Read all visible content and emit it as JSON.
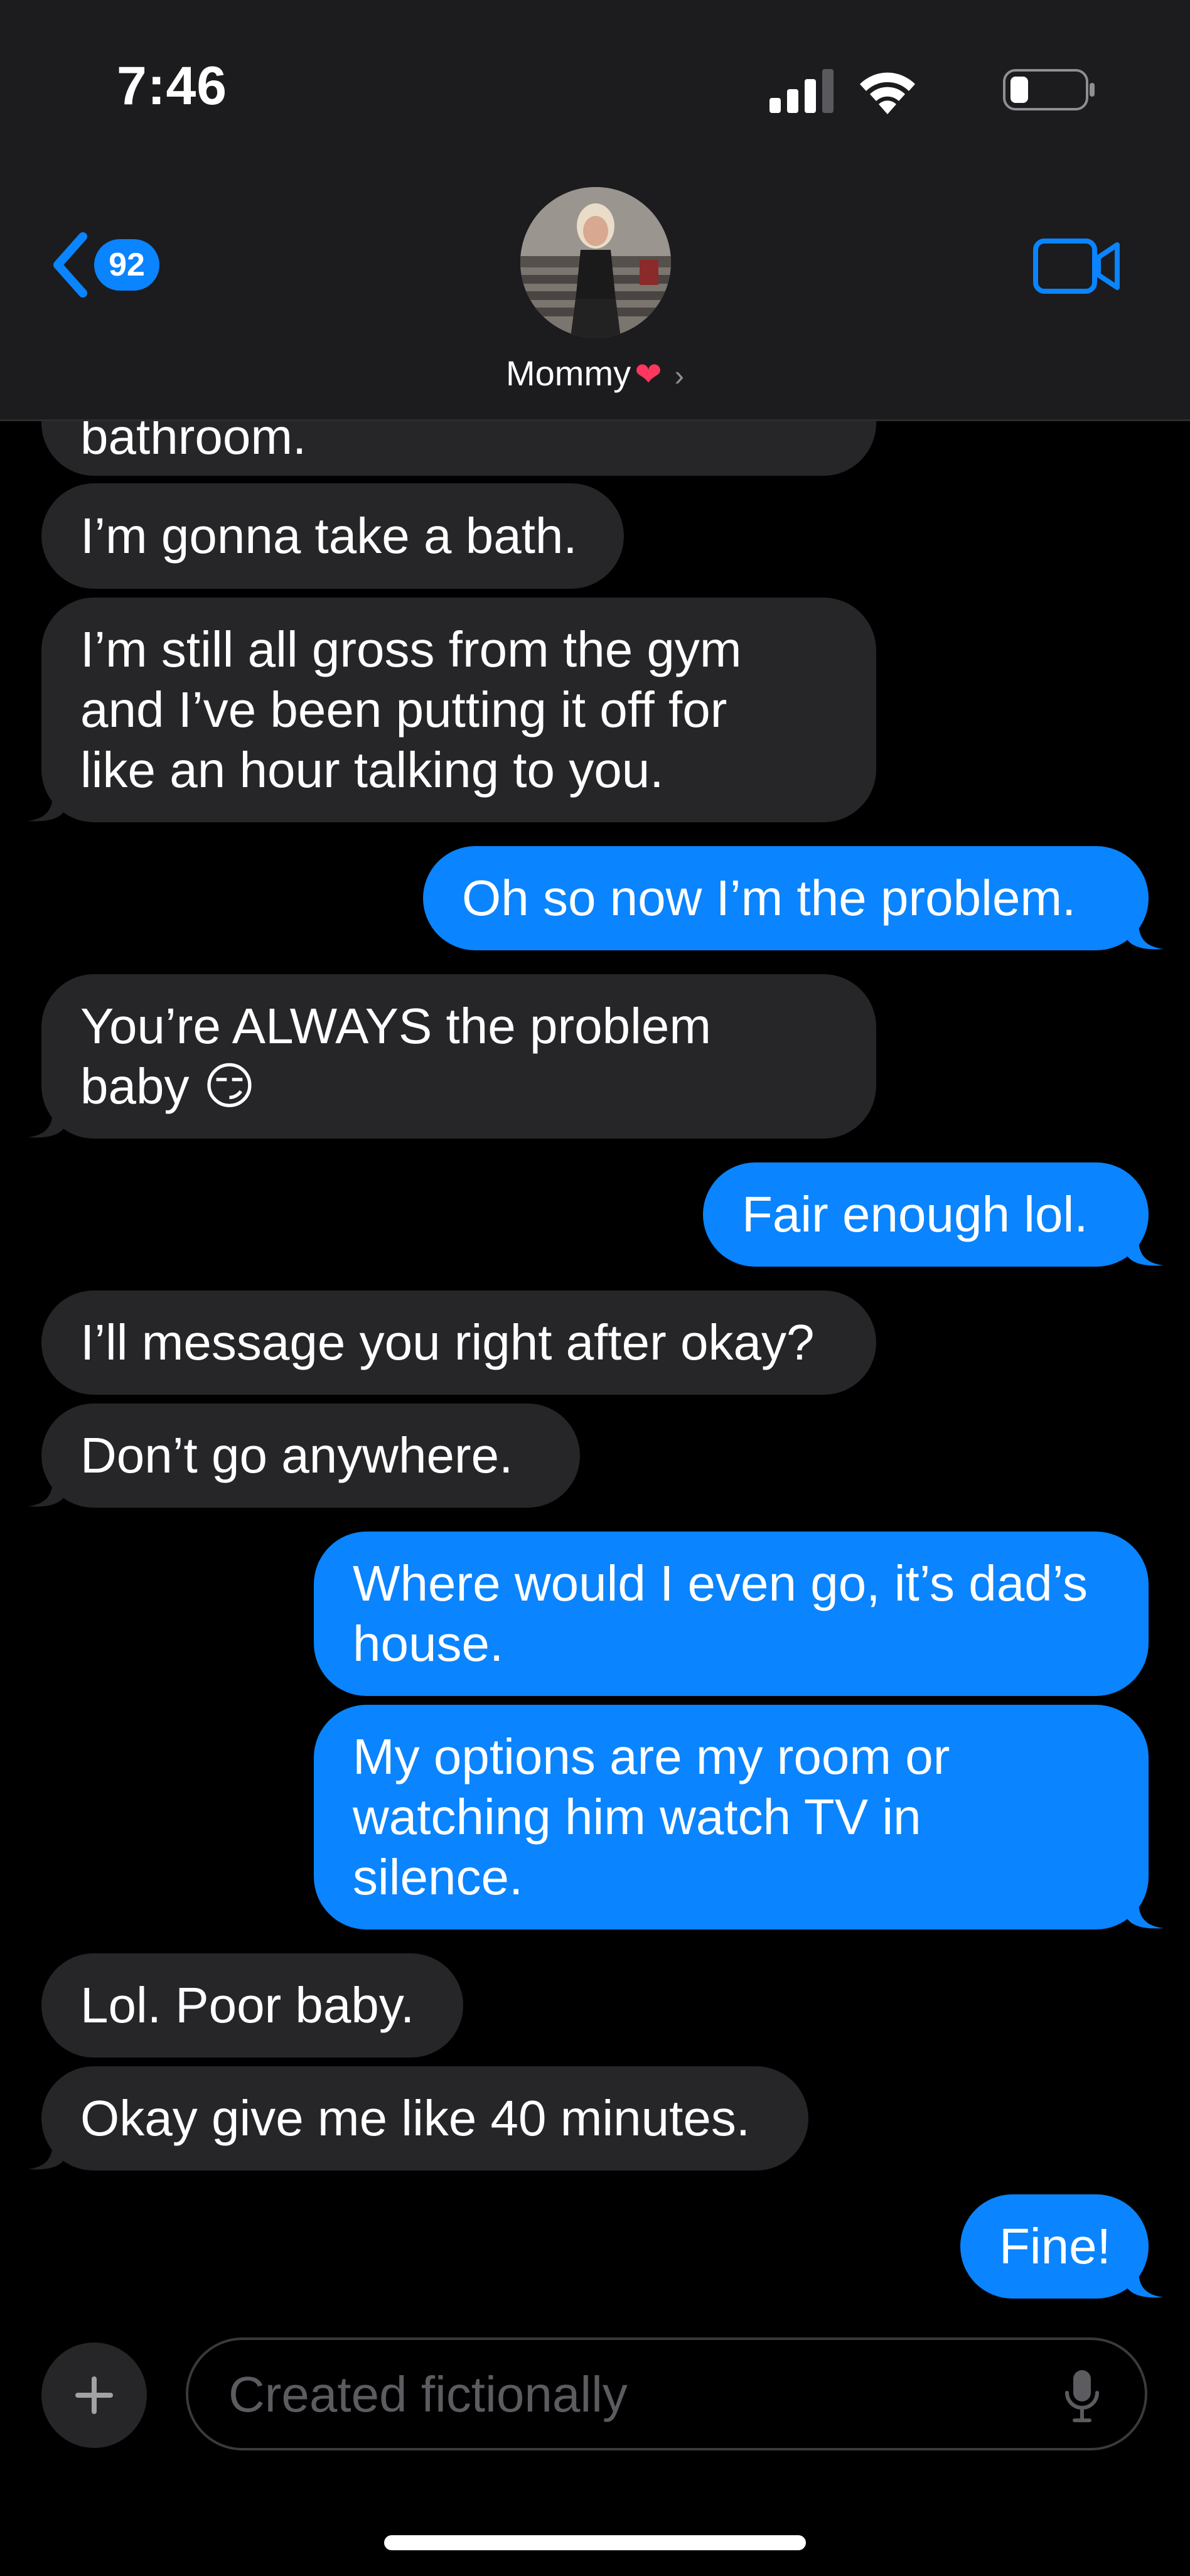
{
  "status_bar": {
    "time": "7:46"
  },
  "header": {
    "unread_count": "92",
    "contact_name": "Mommy",
    "heart_icon": "❤",
    "chevron_icon": "›"
  },
  "messages": [
    {
      "side": "in",
      "text": "bathroom."
    },
    {
      "side": "in",
      "text": "I’m gonna take a bath."
    },
    {
      "side": "in",
      "text": "I’m still all gross from the gym\nand I’ve been putting it off for\nlike an hour talking to you."
    },
    {
      "side": "out",
      "text": "Oh so now I’m the problem."
    },
    {
      "side": "in",
      "text": "You’re ALWAYS the problem\nbaby 😏"
    },
    {
      "side": "out",
      "text": "Fair enough lol."
    },
    {
      "side": "in",
      "text": "I’ll message you right after okay?"
    },
    {
      "side": "in",
      "text": "Don’t go anywhere."
    },
    {
      "side": "out",
      "text": "Where would I even go, it’s dad’s\nhouse."
    },
    {
      "side": "out",
      "text": "My options are my room or\nwatching him watch TV in\nsilence."
    },
    {
      "side": "in",
      "text": "Lol. Poor baby."
    },
    {
      "side": "in",
      "text": "Okay give me like 40 minutes."
    },
    {
      "side": "out",
      "text": "Fine!"
    }
  ],
  "compose": {
    "placeholder": "Created fictionally"
  },
  "colors": {
    "accent": "#0a84ff",
    "incoming_bubble": "#262628",
    "header_bg": "#1c1c1e",
    "background": "#000000"
  }
}
